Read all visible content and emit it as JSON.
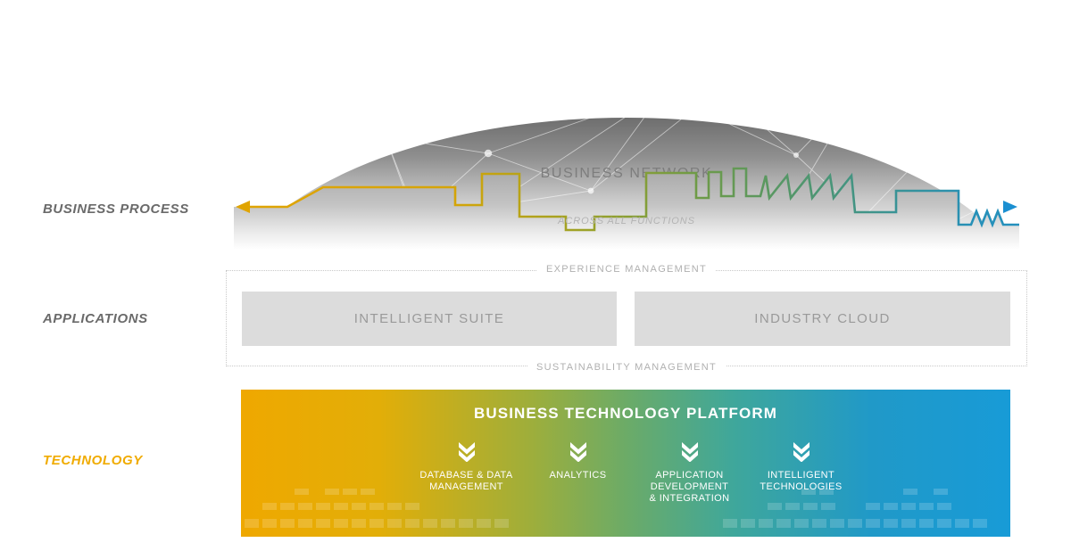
{
  "rows": {
    "business_process": "BUSINESS PROCESS",
    "applications": "APPLICATIONS",
    "technology": "TECHNOLOGY"
  },
  "dome": {
    "title": "BUSINESS NETWORK"
  },
  "process": {
    "caption": "ACROSS ALL FUNCTIONS"
  },
  "applications": {
    "top_band_label": "EXPERIENCE MANAGEMENT",
    "bottom_band_label": "SUSTAINABILITY MANAGEMENT",
    "boxes": [
      {
        "label": "INTELLIGENT SUITE"
      },
      {
        "label": "INDUSTRY CLOUD"
      }
    ]
  },
  "technology": {
    "title": "BUSINESS TECHNOLOGY PLATFORM",
    "pillars": [
      {
        "label": "DATABASE & DATA\nMANAGEMENT",
        "icon": "double-chevron-down-icon"
      },
      {
        "label": "ANALYTICS",
        "icon": "double-chevron-down-icon"
      },
      {
        "label": "APPLICATION\nDEVELOPMENT\n& INTEGRATION",
        "icon": "double-chevron-down-icon"
      },
      {
        "label": "INTELLIGENT\nTECHNOLOGIES",
        "icon": "double-chevron-down-icon"
      }
    ]
  },
  "colors": {
    "accent_orange": "#F0AB00",
    "gradient_start": "#EFA800",
    "gradient_mid_green": "#6CAB67",
    "gradient_end_blue": "#189BD7",
    "line_orange": "#E0A400",
    "line_green": "#6F9B46",
    "line_blue": "#1B8FD1",
    "box_gray": "#DCDCDC",
    "label_gray": "#6A6A6A"
  }
}
